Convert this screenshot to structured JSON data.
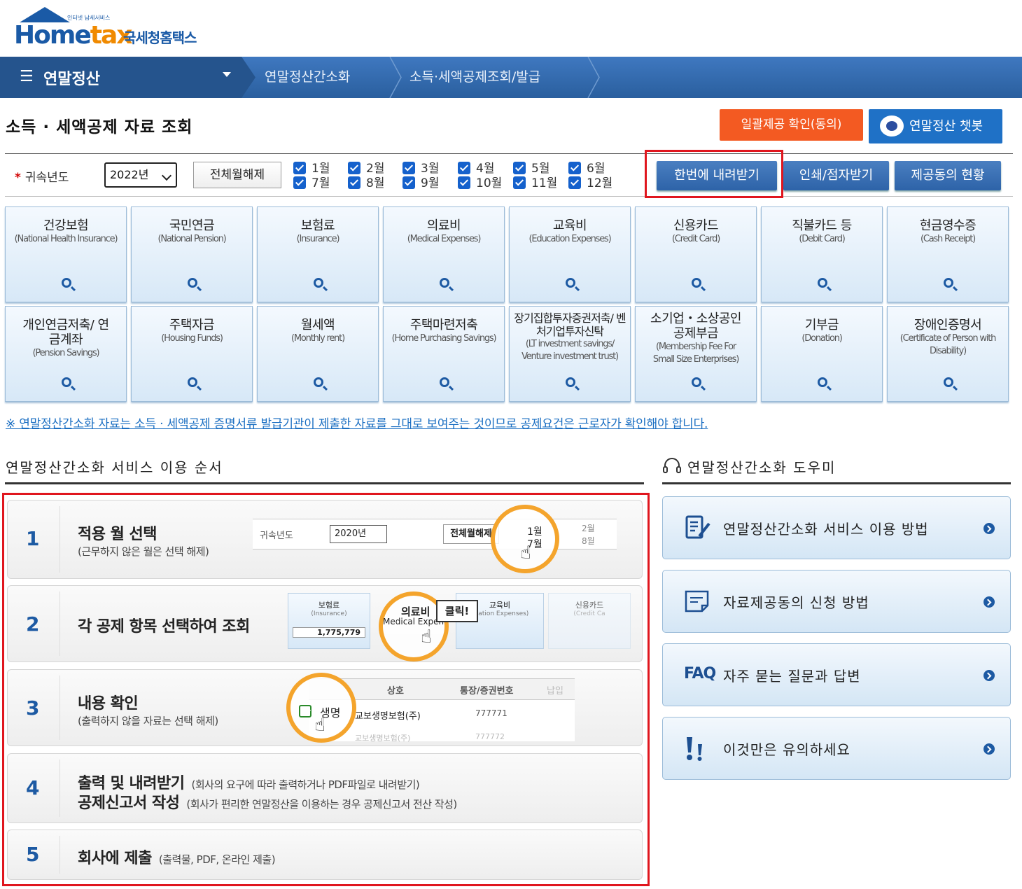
{
  "header": {
    "logo_small": "인터넷 납세서비스",
    "logo_home": "Home",
    "logo_tax": "tax",
    "logo_kr": "국세청홈택스"
  },
  "nav": {
    "menu": "연말정산",
    "crumbs": [
      "연말정산간소화",
      "소득·세액공제조회/발급"
    ]
  },
  "page": {
    "title": "소득 · 세액공제 자료 조회",
    "btn_consent": "일괄제공 확인(동의)",
    "btn_chatbot": "연말정산 챗봇"
  },
  "filter": {
    "year_label": "귀속년도",
    "year_value": "2022년",
    "clear_label": "전체월해제",
    "months_row1": [
      "1월",
      "2월",
      "3월",
      "4월",
      "5월",
      "6월"
    ],
    "months_row2": [
      "7월",
      "8월",
      "9월",
      "10월",
      "11월",
      "12월"
    ],
    "btn_download": "한번에 내려받기",
    "btn_print": "인쇄/점자받기",
    "btn_status": "제공동의 현황"
  },
  "categories": [
    {
      "ko": "건강보험",
      "en": "(National Health Insurance)"
    },
    {
      "ko": "국민연금",
      "en": "(National Pension)"
    },
    {
      "ko": "보험료",
      "en": "(Insurance)"
    },
    {
      "ko": "의료비",
      "en": "(Medical Expenses)"
    },
    {
      "ko": "교육비",
      "en": "(Education Expenses)"
    },
    {
      "ko": "신용카드",
      "en": "(Credit Card)"
    },
    {
      "ko": "직불카드 등",
      "en": "(Debit Card)"
    },
    {
      "ko": "현금영수증",
      "en": "(Cash Receipt)"
    },
    {
      "ko": "개인연금저축/ 연금계좌",
      "en": "(Pension Savings)"
    },
    {
      "ko": "주택자금",
      "en": "(Housing Funds)"
    },
    {
      "ko": "월세액",
      "en": "(Monthly rent)"
    },
    {
      "ko": "주택마련저축",
      "en": "(Home Purchasing Savings)"
    },
    {
      "ko": "장기집합투자증권저축/ 벤처기업투자신탁",
      "en": "(LT investment savings/ Venture investment trust)"
    },
    {
      "ko": "소기업・소상공인 공제부금",
      "en": "(Membership Fee For Small Size Enterprises)"
    },
    {
      "ko": "기부금",
      "en": "(Donation)"
    },
    {
      "ko": "장애인증명서",
      "en": "(Certificate of Person with Disability)"
    }
  ],
  "notice": "※ 연말정산간소화 자료는 소득 · 세액공제 증명서류 발급기관이 제출한 자료를 그대로 보여주는 것이므로 공제요건은 근로자가 확인해야 합니다.",
  "steps_section": {
    "title": "연말정산간소화 서비스 이용 순서",
    "steps": [
      {
        "num": "1",
        "title": "적용 월 선택",
        "sub": "(근무하지 않은 월은 선택 해제)"
      },
      {
        "num": "2",
        "title": "각 공제 항목 선택하여 조회",
        "sub": ""
      },
      {
        "num": "3",
        "title": "내용 확인",
        "sub": "(출력하지 않을 자료는 선택 해제)"
      },
      {
        "num": "4",
        "title": "출력 및 내려받기",
        "sub": "(회사의 요구에 따라 출력하거나 PDF파일로 내려받기)",
        "title2": "공제신고서 작성",
        "sub2": "(회사가 편리한 연말정산을 이용하는 경우 공제신고서 전산 작성)"
      },
      {
        "num": "5",
        "title": "회사에 제출",
        "sub": "(출력물, PDF, 온라인 제출)"
      }
    ],
    "illus1": {
      "label": "귀속년도",
      "year": "2020년",
      "btn": "전체월해제",
      "m1": "1월",
      "m7": "7월",
      "m2": "2월",
      "m8": "8월"
    },
    "illus2": {
      "t1": "보험료",
      "e1": "(Insurance)",
      "amt": "1,775,779",
      "t2": "의료비",
      "e2": "Medical Expen",
      "click": "클릭!",
      "t3": "교육비",
      "e3": "ucation Expenses)",
      "t4": "신용카드",
      "e4": "(Credit Ca"
    },
    "illus3": {
      "h1": "상호",
      "h2": "통장/증권번호",
      "h3": "납입",
      "row": "생명",
      "row_rest": "교보생명보험(주)",
      "num": "777771",
      "row2": "교보생명보험(주)",
      "num2": "777772"
    }
  },
  "help_section": {
    "title": "연말정산간소화 도우미",
    "items": [
      "연말정산간소화 서비스 이용 방법",
      "자료제공동의 신청 방법",
      "자주 묻는 질문과 답변",
      "이것만은 유의하세요"
    ],
    "faq_icon_text": "FAQ"
  }
}
